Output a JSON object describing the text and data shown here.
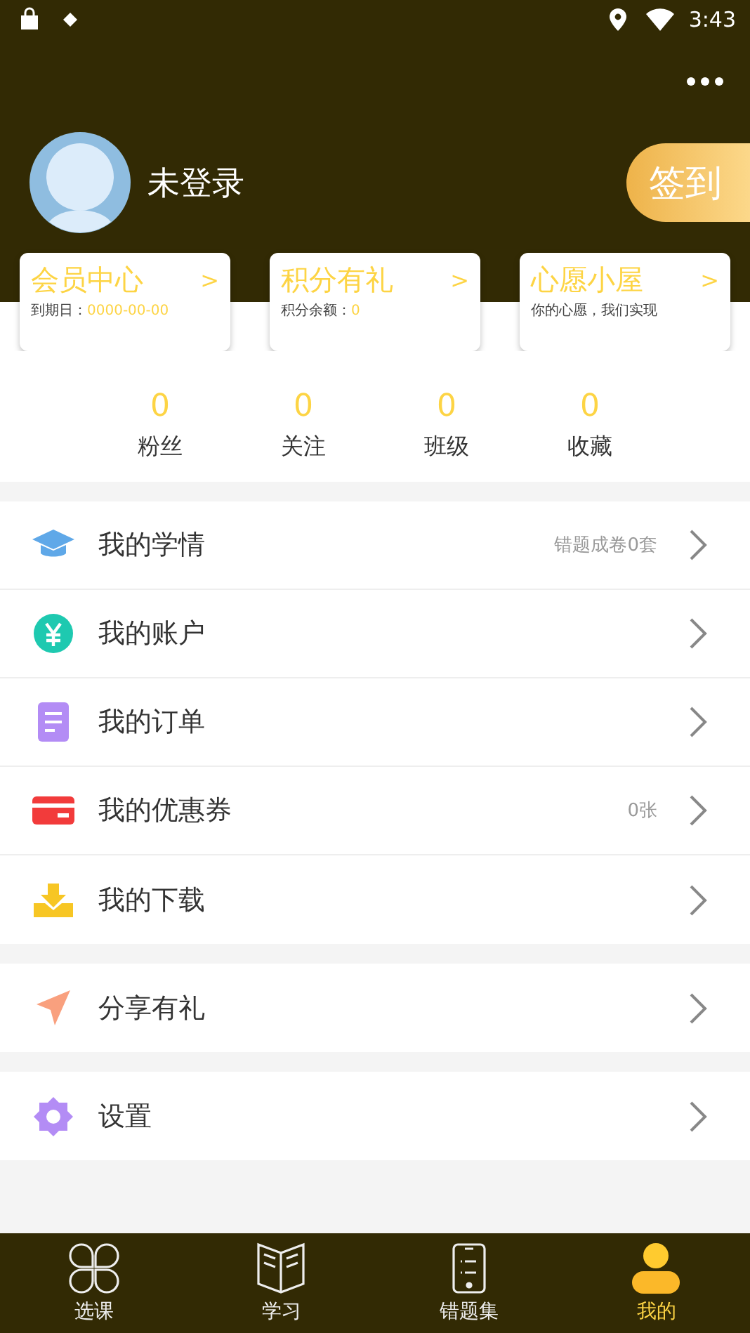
{
  "status_bar": {
    "time": "3:43"
  },
  "profile": {
    "name": "未登录",
    "checkin_button": "签到"
  },
  "cards": [
    {
      "title": "会员中心",
      "arrow": ">",
      "label": "到期日：",
      "value": "0000-00-00"
    },
    {
      "title": "积分有礼",
      "arrow": ">",
      "label": "积分余额：",
      "value": "0"
    },
    {
      "title": "心愿小屋",
      "arrow": ">",
      "label": "你的心愿，我们实现"
    }
  ],
  "stats": [
    {
      "count": "0",
      "label": "粉丝"
    },
    {
      "count": "0",
      "label": "关注"
    },
    {
      "count": "0",
      "label": "班级"
    },
    {
      "count": "0",
      "label": "收藏"
    }
  ],
  "menu_groups": [
    [
      {
        "kind": "study",
        "label": "我的学情",
        "note": "错题成卷0套"
      },
      {
        "kind": "account",
        "label": "我的账户"
      },
      {
        "kind": "order",
        "label": "我的订单"
      },
      {
        "kind": "coupon",
        "label": "我的优惠券",
        "note": "0张"
      },
      {
        "kind": "download",
        "label": "我的下载"
      }
    ],
    [
      {
        "kind": "share",
        "label": "分享有礼"
      }
    ],
    [
      {
        "kind": "settings",
        "label": "设置"
      }
    ]
  ],
  "tab_bar": [
    {
      "kind": "courses",
      "label": "选课",
      "selected": false
    },
    {
      "kind": "study",
      "label": "学习",
      "selected": false
    },
    {
      "kind": "mistakes",
      "label": "错题集",
      "selected": false
    },
    {
      "kind": "mine",
      "label": "我的",
      "selected": true
    }
  ]
}
